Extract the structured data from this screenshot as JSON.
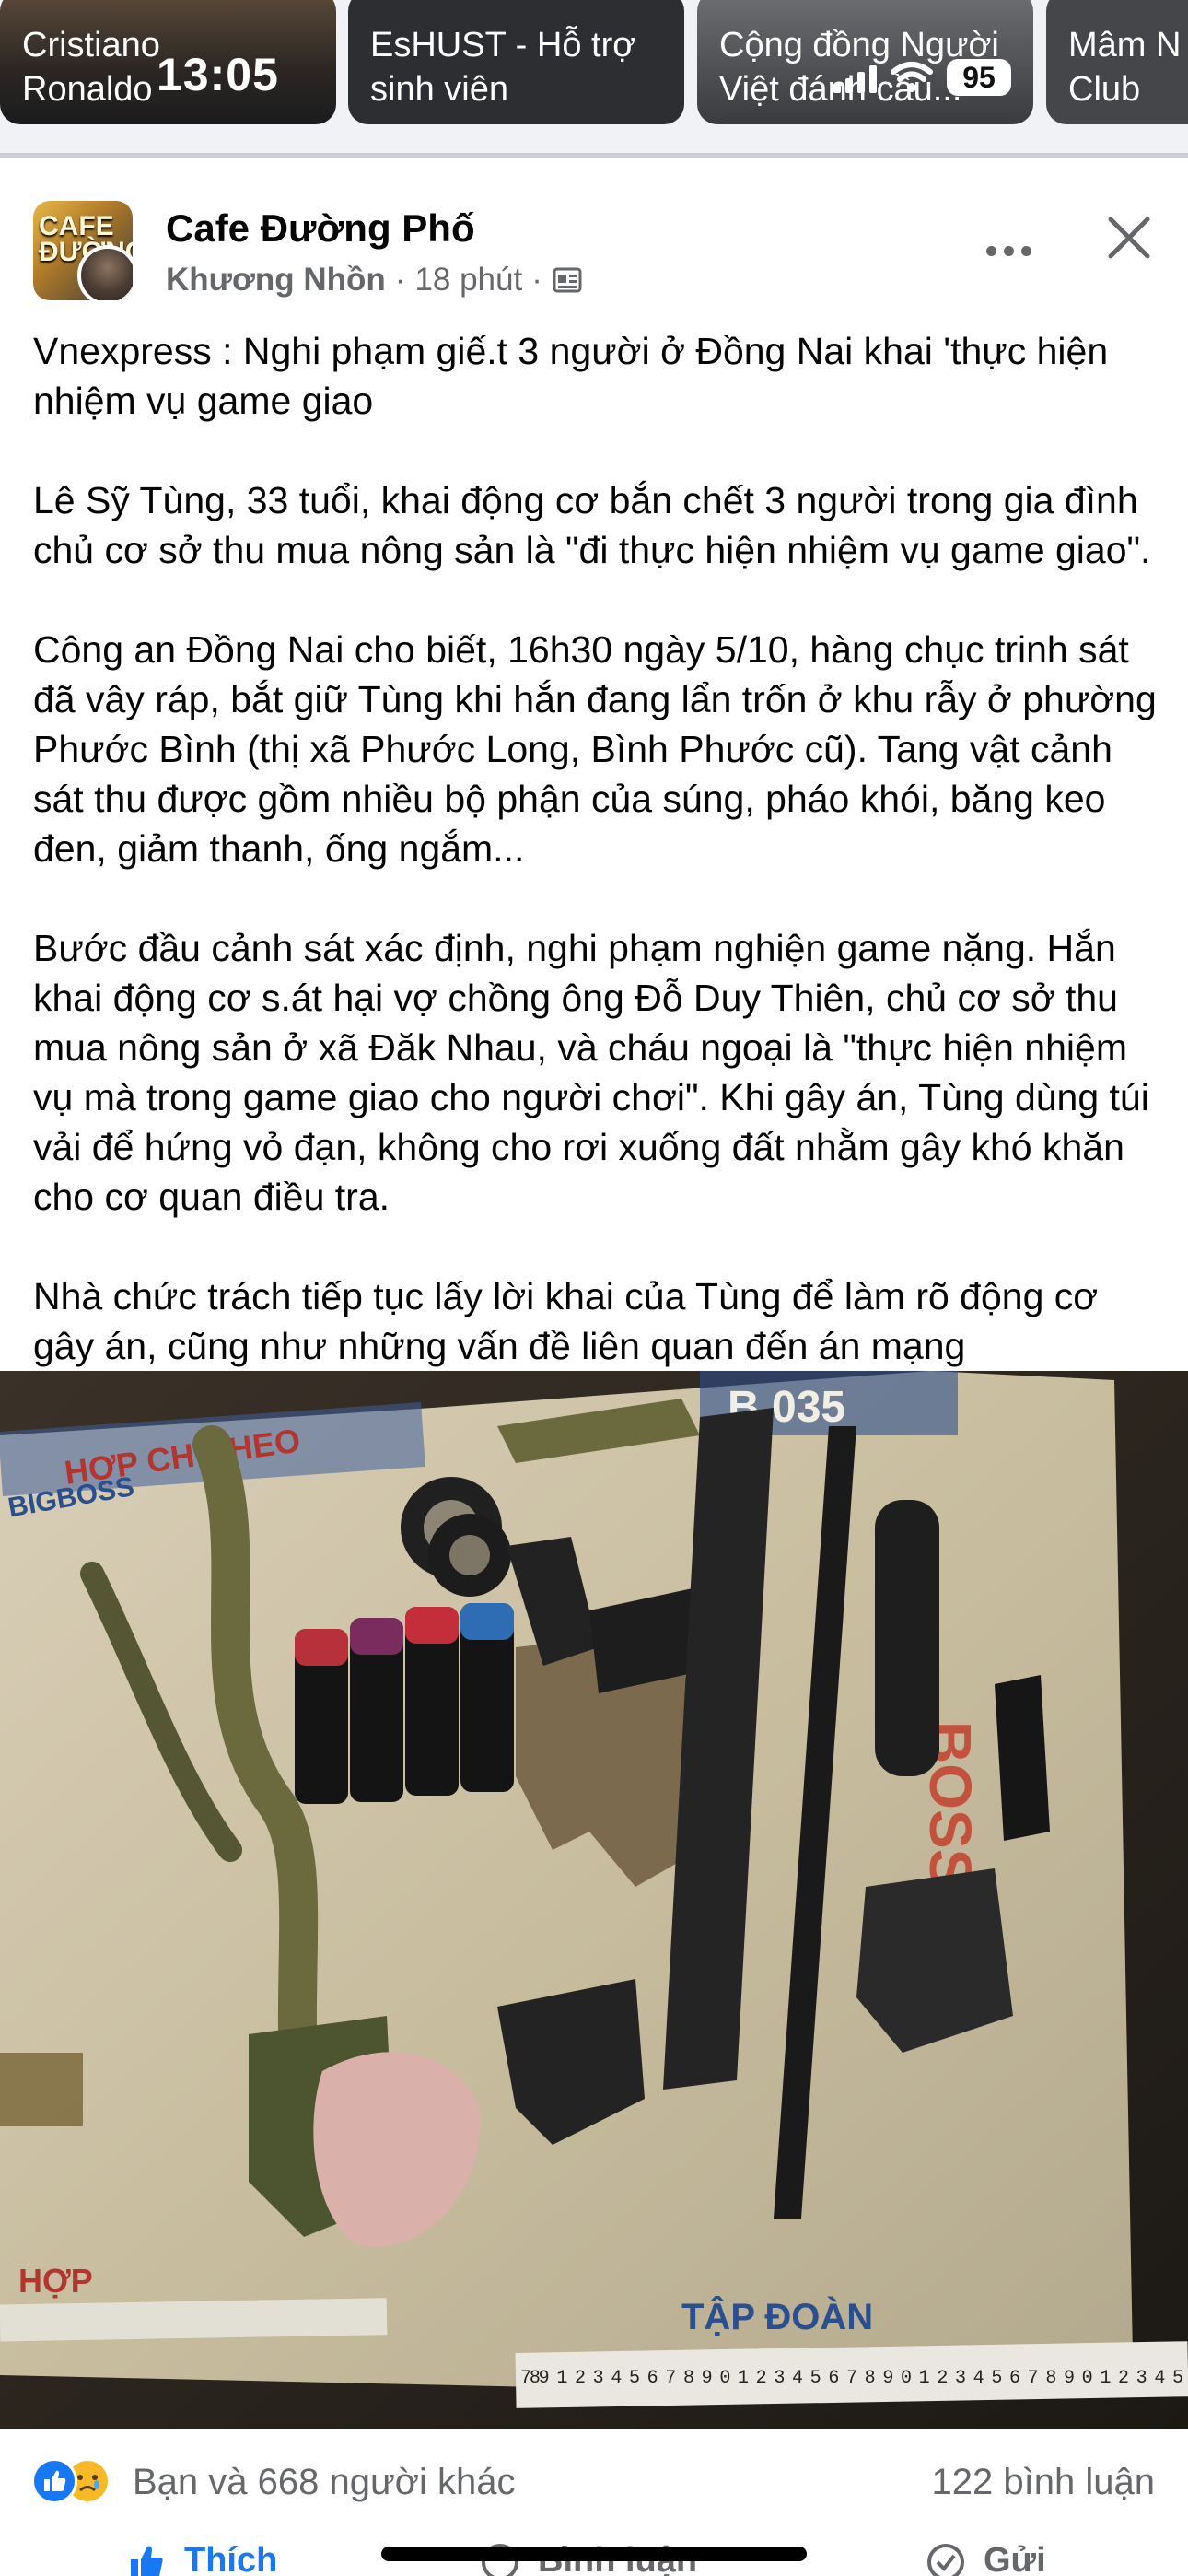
{
  "status_bar": {
    "time": "13:05",
    "battery": "95"
  },
  "stories": [
    {
      "label": "Cristiano\nRonaldo"
    },
    {
      "label": "EsHUST - Hỗ trợ\nsinh viên"
    },
    {
      "label": "Cộng đồng Người\nViệt đánh cầu..."
    },
    {
      "label": "Mâm N\nClub"
    }
  ],
  "post": {
    "page_name": "Cafe Đường Phố",
    "avatar_text": "CAFE\nĐƯỜNG",
    "author": "Khương Nhồn",
    "time": "18 phút",
    "separator": "·",
    "paragraphs": [
      "Vnexpress : Nghi phạm giế.t 3 người ở Đồng Nai khai 'thực hiện nhiệm vụ game giao",
      "Lê Sỹ Tùng, 33 tuổi, khai động cơ bắn chết 3 người trong gia đình chủ cơ sở thu mua nông sản là \"đi thực hiện nhiệm vụ game giao\".",
      "Công an Đồng Nai cho biết, 16h30 ngày 5/10, hàng chục trinh sát đã vây ráp, bắt giữ Tùng khi hắn đang lẩn trốn ở khu rẫy ở phường Phước Bình (thị xã Phước Long, Bình Phước cũ). Tang vật cảnh sát thu được gồm nhiều bộ phận của súng, pháo khói, băng keo đen, giảm thanh, ống ngắm...",
      "Bước đầu cảnh sát xác định, nghi phạm nghiện game nặng. Hắn khai động cơ s.át hại vợ chồng ông Đỗ Duy Thiên, chủ cơ sở thu mua nông sản ở xã Đăk Nhau, và cháu ngoại là \"thực hiện nhiệm vụ mà trong game giao cho người chơi\". Khi gây án, Tùng dùng túi vải để hứng vỏ đạn, không cho rơi xuống đất nhằm gây khó khăn cho cơ quan điều tra.",
      "Nhà chức trách tiếp tục lấy lời khai của Tùng để làm rõ động cơ gây án, cũng như những vấn đề liên quan đến án mạng"
    ],
    "photo_texts": {
      "top_left": "HỢP CHO HEO",
      "brand": "BIGBOSS",
      "top_right": "B 035",
      "right": "BOSS",
      "bottom_left": "HỢP",
      "bottom": "TẬP ĐOÀN",
      "ruler": "789 1 2 3 4 5 6 7 8 9 0 1 2 3 4 5 6 7 8 9 0 1 2 3 4 5 6 7 8 9 0 1 2 3 4 5"
    }
  },
  "reactions": {
    "summary": "Bạn và 668 người khác",
    "comments": "122 bình luận"
  },
  "actions": {
    "like": "Thích",
    "comment": "Bình luận",
    "share": "Gửi"
  },
  "colors": {
    "facebook_blue": "#1877f2",
    "secondary_text": "#65676b",
    "sad_yellow": "#f7b928"
  }
}
